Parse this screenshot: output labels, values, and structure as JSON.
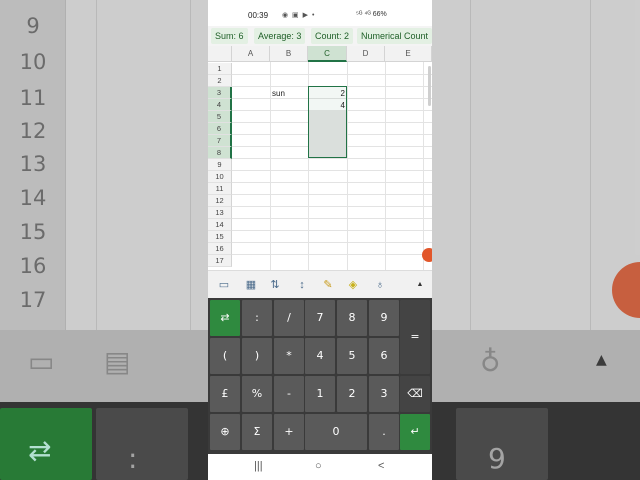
{
  "status": {
    "time": "00:39",
    "icons": "◉ ▣ ▶ •",
    "right": "⁵ᴳ ⁴ᴳ 66%"
  },
  "sumbar": {
    "sum": "Sum: 6",
    "average": "Average: 3",
    "count": "Count: 2",
    "numerical_count": "Numerical Count"
  },
  "sheet": {
    "columns": [
      "A",
      "B",
      "C",
      "D",
      "E"
    ],
    "selected_column": "C",
    "rows": [
      "1",
      "2",
      "3",
      "4",
      "5",
      "6",
      "7",
      "8",
      "9",
      "10",
      "11",
      "12",
      "13",
      "14",
      "15",
      "16",
      "17"
    ],
    "cells": {
      "B3": "sun",
      "C3": "2",
      "C4": "4"
    }
  },
  "background": {
    "rows": [
      "9",
      "10",
      "11",
      "12",
      "13",
      "14",
      "15",
      "16",
      "17"
    ]
  },
  "toolbar": {
    "icons": [
      "comment-icon",
      "table-icon",
      "sort-icon",
      "row-height-icon",
      "edit-icon",
      "fill-color-icon",
      "lightbulb-icon",
      "expand-up-icon"
    ]
  },
  "keypad": {
    "row1": [
      "⇄",
      ":",
      "/",
      "7",
      "8",
      "9"
    ],
    "row2": [
      "(",
      ")",
      "*",
      "4",
      "5",
      "6"
    ],
    "row3": [
      "£",
      "%",
      "-",
      "1",
      "2",
      "3"
    ],
    "row4": [
      "⊕",
      "Σ",
      "+",
      "0",
      "."
    ],
    "equals": "=",
    "backspace": "⌫",
    "enter": "↵"
  },
  "nav": {
    "recents": "|||",
    "home": "○",
    "back": "<"
  },
  "colors": {
    "accent": "#217346",
    "keypad_bg": "#3a3a3a",
    "key_bg": "#5a5a5a",
    "green_key": "#2f8a3f"
  }
}
